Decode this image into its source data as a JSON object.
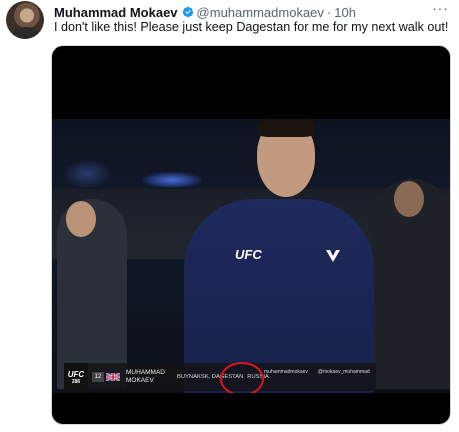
{
  "tweet": {
    "author_name": "Muhammad Mokaev",
    "handle": "@muhammadmokaev",
    "separator": "·",
    "time": "10h",
    "text": "I don't like this! Please just keep Dagestan for me for my next walk out!",
    "more_label": "···"
  },
  "media": {
    "chest_logo": "UFC",
    "lower_third": {
      "event_logo": "UFC",
      "event_number": "286",
      "rank": "12",
      "fighter_first": "MUHAMMAD",
      "fighter_last": "MOKAEV",
      "hometown": "BUYNAKSK, DAGESTAN",
      "country": "RUSSIA",
      "handle_1": "muhammadmokaev",
      "handle_2": "@mokaev_muhammad"
    },
    "annotation_color": "#e0141a"
  },
  "colors": {
    "text": "#0f1419",
    "secondary": "#536471",
    "verified": "#1d9bf0"
  },
  "icons": {
    "verified": "verified-badge-icon",
    "more": "more-options-icon",
    "flag": "uk-flag-icon"
  }
}
